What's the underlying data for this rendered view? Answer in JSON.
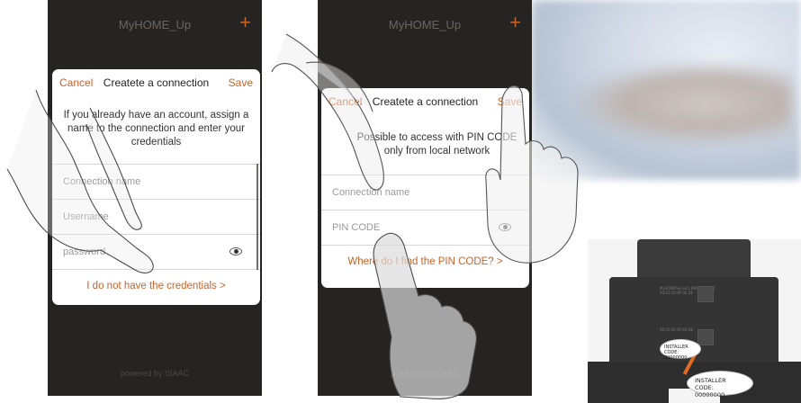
{
  "phones": [
    {
      "app_title": "MyHOME_Up",
      "plus_label": "+",
      "footer": "powered by ISAAC",
      "dialog": {
        "cancel": "Cancel",
        "title": "Createte a connection",
        "save": "Save",
        "text": "If you already have an account, assign a name to the connection and enter your credentials",
        "fields": [
          {
            "placeholder": "Connection name"
          },
          {
            "placeholder": "Username"
          },
          {
            "placeholder": "password",
            "icon": "eye-icon"
          }
        ],
        "link": "I do not have the credentials >"
      }
    },
    {
      "app_title": "MyHOME_Up",
      "plus_label": "+",
      "footer": "powered by ISAAC",
      "dialog": {
        "cancel": "Cancel",
        "title": "Createte a connection",
        "save": "Save",
        "text": "Possible to access with PIN CODE only from local network",
        "fields": [
          {
            "placeholder": "Connection name"
          },
          {
            "placeholder": "PIN CODE",
            "icon": "eye-icon"
          }
        ],
        "link": "Where do I find the PIN CODE? >"
      }
    }
  ],
  "device": {
    "label_top": "MyHOMEServer1 BMPS-IQ MAC 00:03:50:8F:9E:DE",
    "label_mid": "00:03:50 8F:9E:DE",
    "callout_small": "INSTALLER CODE: 00000000",
    "callout_big": "INSTALLER CODE: 00000000"
  },
  "colors": {
    "accent": "#c8632b",
    "phone_bg": "#252422",
    "dialog_bg": "#ffffff"
  }
}
